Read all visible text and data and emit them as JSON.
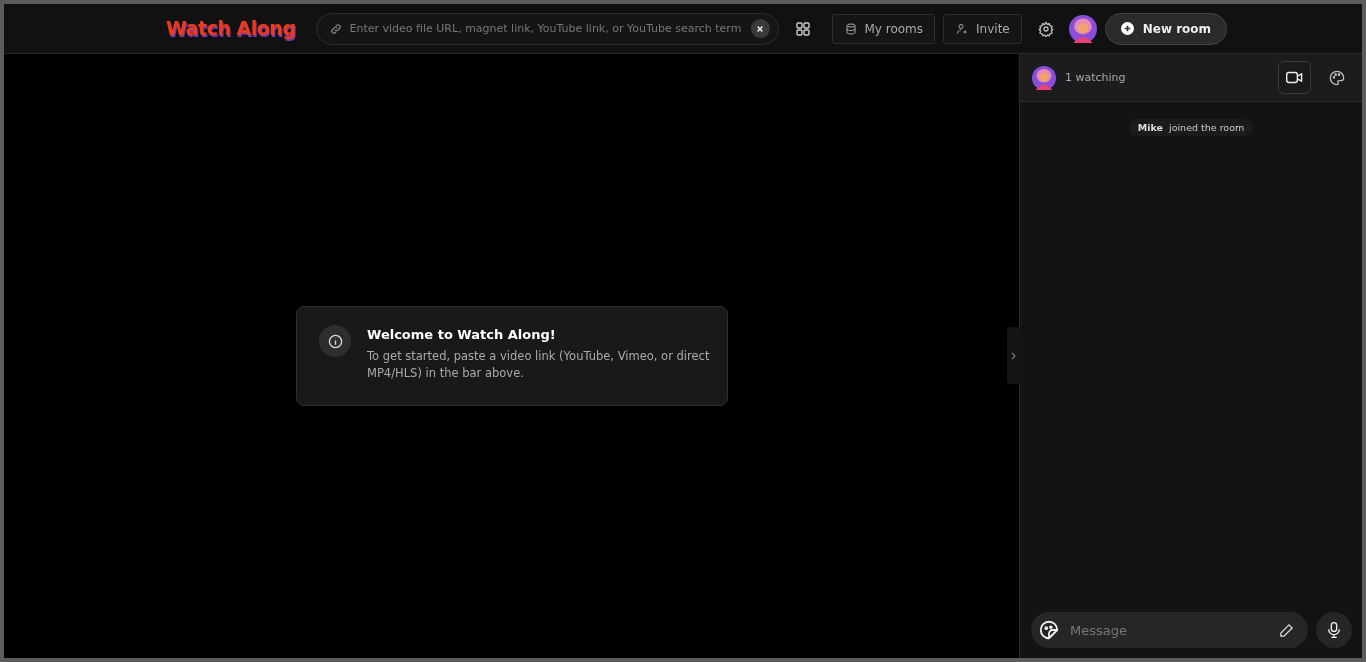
{
  "header": {
    "logo": "Watch Along",
    "search": {
      "placeholder": "Enter video file URL, magnet link, YouTube link, or YouTube search term"
    },
    "buttons": [
      {
        "kind": "rooms",
        "label": "My rooms"
      },
      {
        "kind": "invite",
        "label": "Invite"
      }
    ],
    "new_room": "New room"
  },
  "welcome": {
    "title": "Welcome to Watch Along!",
    "text": "To get started, paste a video link (YouTube, Vimeo, or direct MP4/HLS) in the bar above."
  },
  "sidebar": {
    "watching": "1 watching",
    "video_toggle": {
      "selected": true
    },
    "messages": [
      {
        "user": "Mike",
        "text": "joined the room"
      }
    ],
    "composer": {
      "placeholder": "Message"
    }
  }
}
